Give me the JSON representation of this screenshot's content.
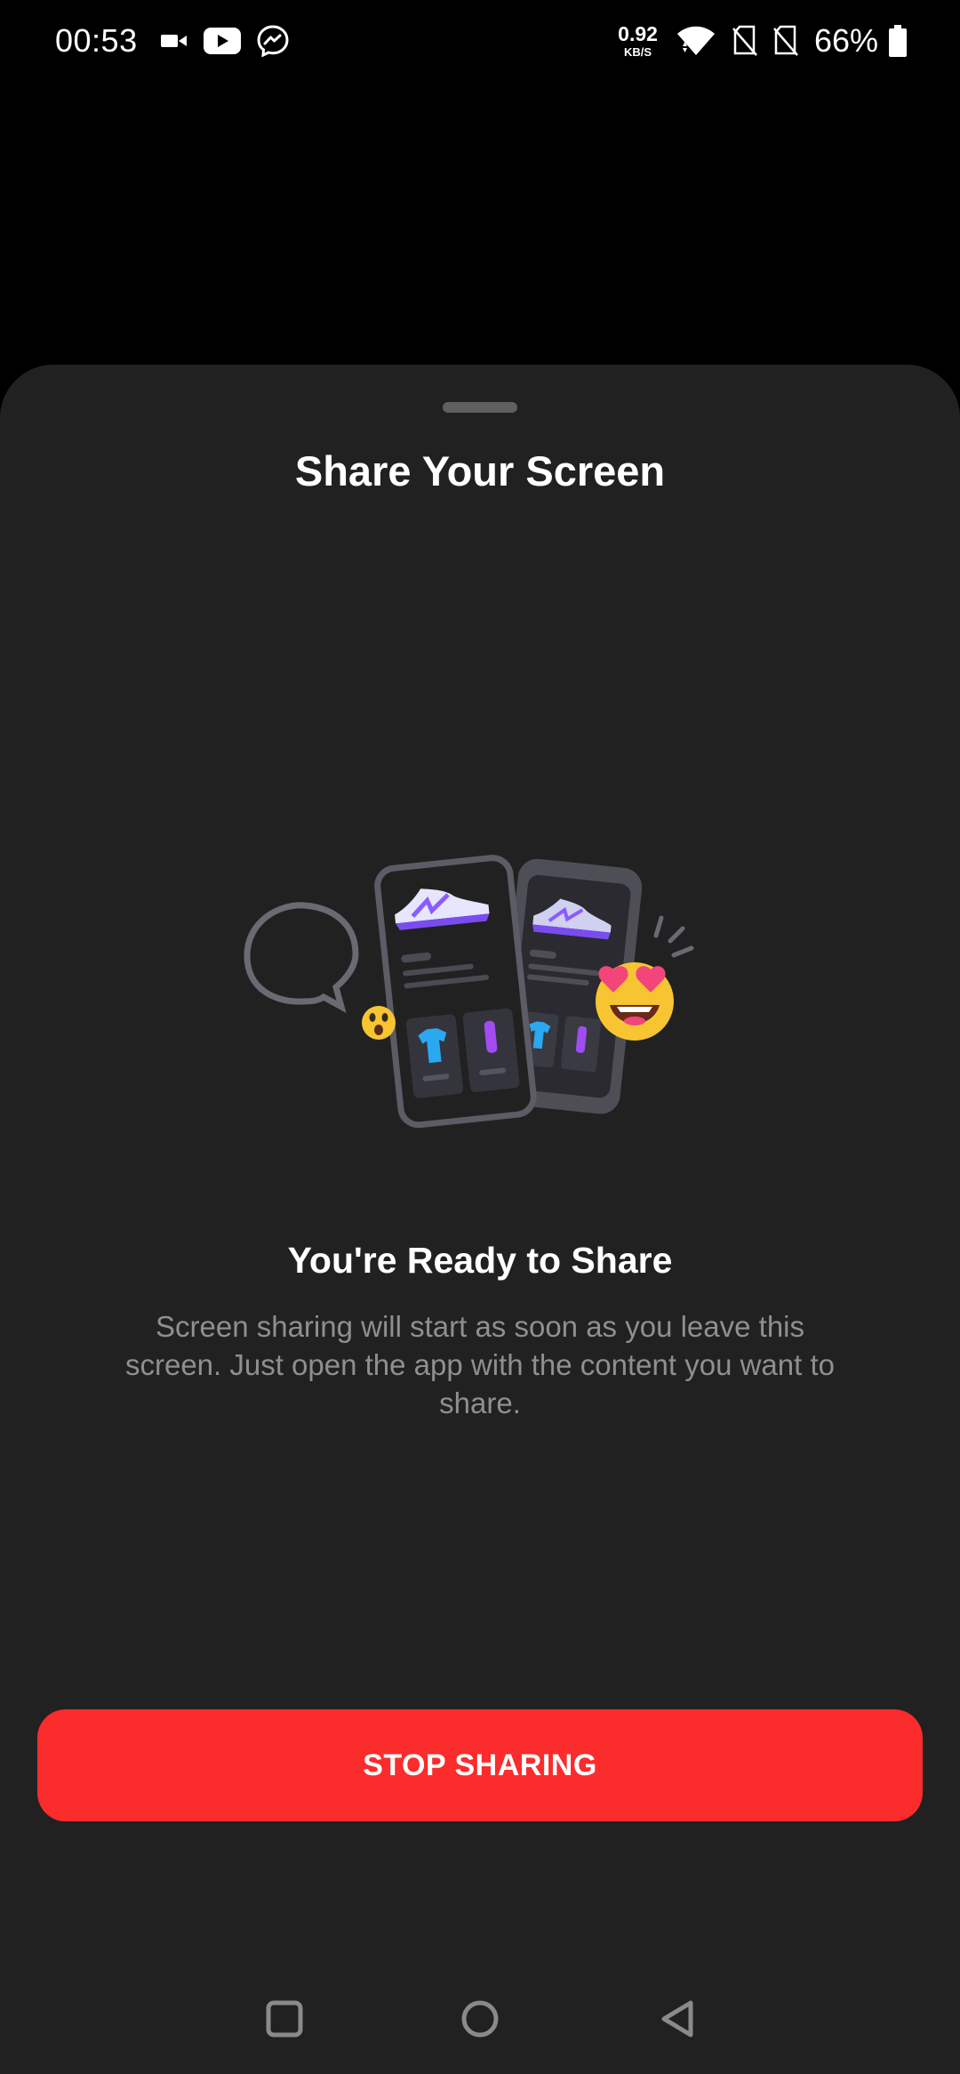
{
  "status_bar": {
    "time": "00:53",
    "net_speed_value": "0.92",
    "net_speed_unit": "KB/S",
    "battery_percent": "66%",
    "left_icons": [
      "video-camera-icon",
      "youtube-icon",
      "messenger-icon"
    ],
    "right_icons": [
      "wifi-icon",
      "no-sim-icon",
      "no-sim-icon",
      "battery-icon"
    ]
  },
  "sheet": {
    "title": "Share Your Screen",
    "ready_title": "You're Ready to Share",
    "ready_body": "Screen sharing will start as soon as you leave this screen. Just open the app with the content you want to share.",
    "stop_button_label": "STOP SHARING"
  },
  "nav_bar": {
    "buttons": [
      "recents-square-icon",
      "home-circle-icon",
      "back-triangle-icon"
    ]
  },
  "colors": {
    "sheet_background": "#212121",
    "accent_red": "#fb2c2c",
    "body_text_gray": "#8f8f8f"
  }
}
